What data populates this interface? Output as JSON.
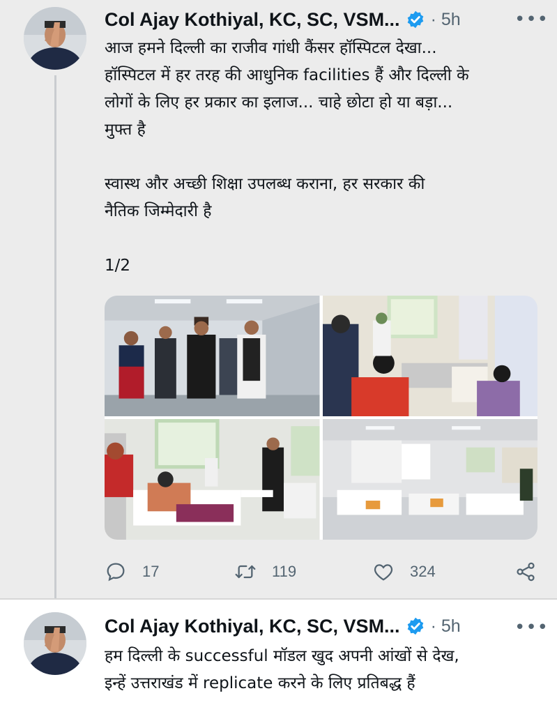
{
  "tweets": [
    {
      "author": "Col Ajay Kothiyal, KC, SC, VSM...",
      "time": "· 5h",
      "more": "•••",
      "text_lines": [
        "आज हमने दिल्ली का राजीव गांधी कैंसर हॉस्पिटल देखा...",
        "हॉस्पिटल में हर तरह की आधुनिक facilities हैं और दिल्ली के",
        "लोगों के लिए हर प्रकार का इलाज... चाहे छोटा हो या बड़ा...",
        "मुफ्त है"
      ],
      "text_lines_2": [
        "स्वास्थ और अच्छी शिक्षा उपलब्ध कराना, हर सरकार की",
        "नैतिक जिम्मेदारी है"
      ],
      "thread_marker": "1/2",
      "actions": {
        "replies": "17",
        "retweets": "119",
        "likes": "324"
      }
    },
    {
      "author": "Col Ajay Kothiyal, KC, SC, VSM...",
      "time": "· 5h",
      "more": "•••",
      "text_lines": [
        "हम दिल्ली के successful मॉडल खुद अपनी आंखों से देख,",
        "इन्हें उत्तराखंड में replicate करने के लिए प्रतिबद्ध हैं"
      ]
    }
  ],
  "icons": {
    "verified": "verified-badge-icon",
    "reply": "reply-icon",
    "retweet": "retweet-icon",
    "like": "heart-icon",
    "share": "share-icon"
  },
  "colors": {
    "verified_blue": "#1d9bf0",
    "secondary_text": "#536471",
    "thread_line": "#c9ccd0"
  }
}
